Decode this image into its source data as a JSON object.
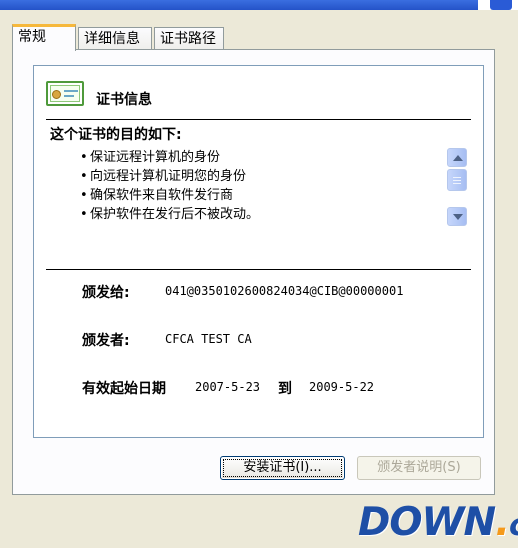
{
  "tabs": [
    {
      "label": "常规",
      "active": true
    },
    {
      "label": "详细信息",
      "active": false
    },
    {
      "label": "证书路径",
      "active": false
    }
  ],
  "certificate": {
    "icon": "certificate-icon",
    "title": "证书信息",
    "purpose_heading": "这个证书的目的如下:",
    "purposes": [
      "保证远程计算机的身份",
      "向远程计算机证明您的身份",
      "确保软件来自软件发行商",
      "保护软件在发行后不被改动。"
    ],
    "issued_to_label": "颁发给:",
    "issued_to": "041@0350102600824034@CIB@00000001",
    "issued_by_label": "颁发者:",
    "issued_by": "CFCA TEST CA",
    "valid_label": "有效起始日期",
    "valid_from": "2007-5-23",
    "to_label": "到",
    "valid_to": "2009-5-22"
  },
  "buttons": {
    "install": "安装证书(I)...",
    "issuer_statement": "颁发者说明(S)"
  },
  "watermark": {
    "main": "DOWN",
    "dot": ".",
    "suffix": "cc"
  },
  "colors": {
    "window_bg": "#ece9d8",
    "active_tab_accent": "#f6b83c",
    "watermark_blue": "#1e4fa6",
    "watermark_orange": "#f59a1b"
  }
}
